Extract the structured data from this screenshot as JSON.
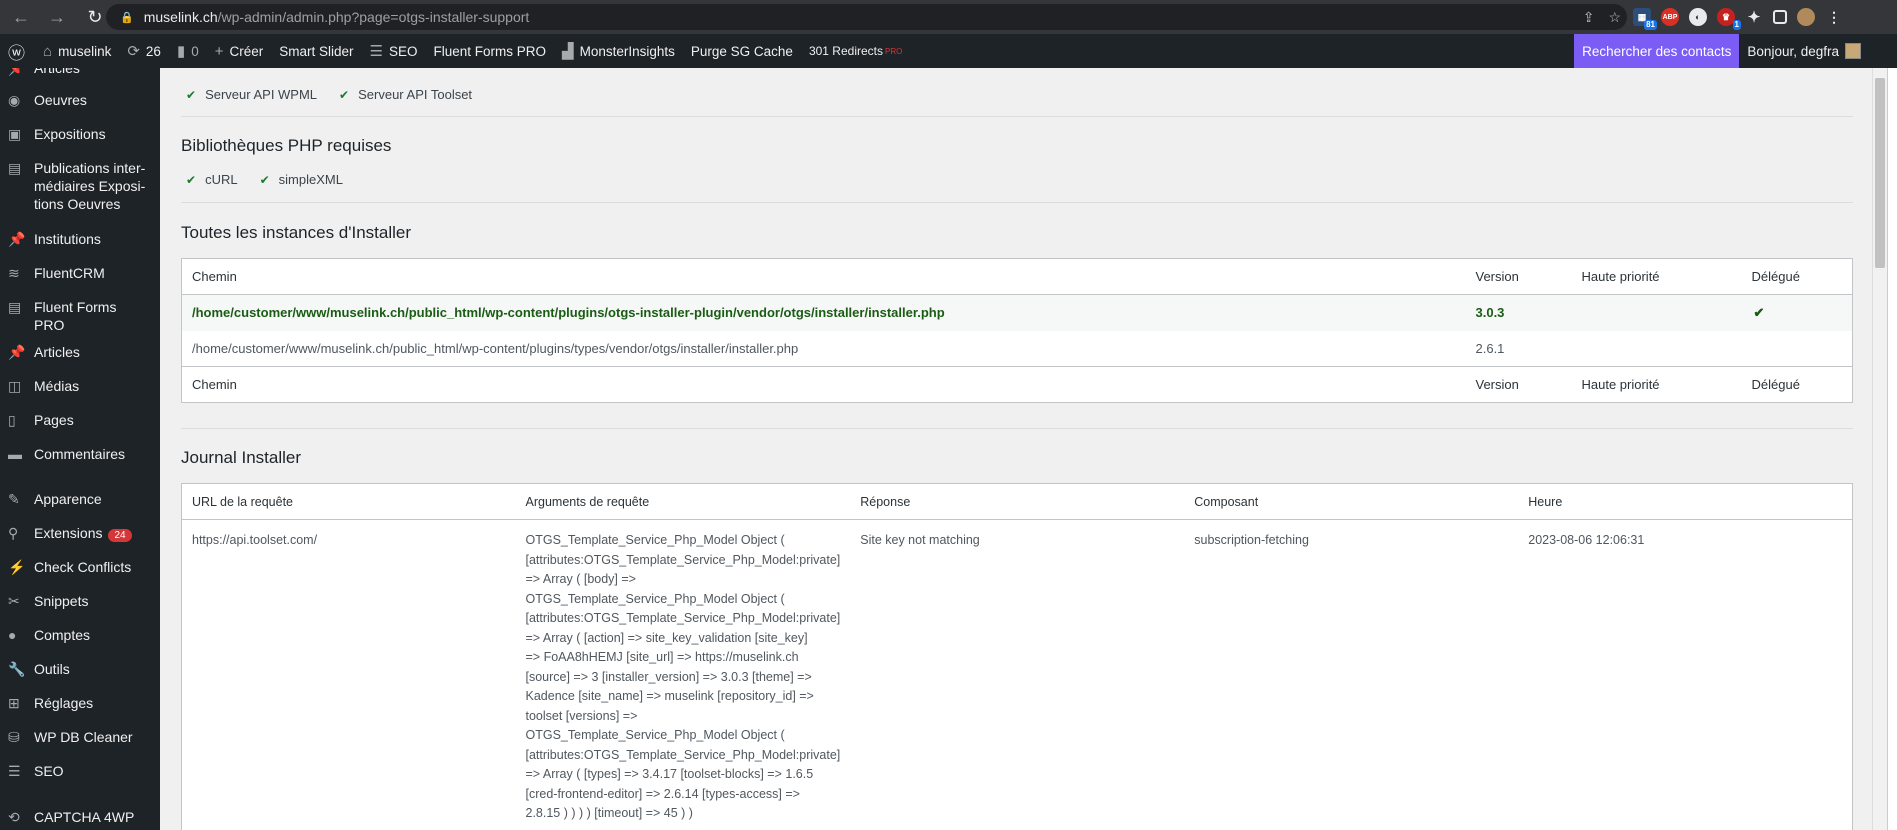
{
  "browser": {
    "url_host": "muselink.ch",
    "url_path": "/wp-admin/admin.php?page=otgs-installer-support",
    "extensions": [
      {
        "name": "ext-a",
        "badge": "81",
        "color": "#2d4d7a"
      },
      {
        "name": "adblock",
        "badge": "",
        "color": "#d93025",
        "text": "ABP"
      },
      {
        "name": "ext-c",
        "badge": "",
        "color": "#e8eaed"
      },
      {
        "name": "ext-d",
        "badge": "1",
        "color": "#c5221f"
      }
    ]
  },
  "adminbar": {
    "site_name": "muselink",
    "updates_count": "26",
    "comments_count": "0",
    "create_label": "Créer",
    "smart_slider": "Smart Slider",
    "seo": "SEO",
    "fluent_forms": "Fluent Forms PRO",
    "monsterinsights": "MonsterInsights",
    "purge_cache": "Purge SG Cache",
    "redirects": "301 Redirects",
    "redirects_badge": "PRO",
    "contacts_button": "Rechercher des contacts",
    "greeting": "Bonjour, degfra"
  },
  "sidebar": {
    "items": [
      {
        "label": "Articles",
        "icon": "pin-icon"
      },
      {
        "label": "Oeuvres",
        "icon": "palette-icon"
      },
      {
        "label": "Expositions",
        "icon": "image-icon"
      },
      {
        "label": "Publications inter-médiaires Exposi-tions Oeuvres",
        "lines": [
          "Publications inter-",
          "médiaires Exposi-",
          "tions Oeuvres"
        ],
        "icon": "store-icon"
      },
      {
        "label": "Institutions",
        "icon": "pin-icon"
      },
      {
        "label": "FluentCRM",
        "icon": "crm-icon"
      },
      {
        "label": "Fluent Forms PRO",
        "icon": "forms-icon"
      },
      {
        "label": "Articles",
        "icon": "pin-icon"
      },
      {
        "label": "Médias",
        "icon": "media-icon"
      },
      {
        "label": "Pages",
        "icon": "page-icon"
      },
      {
        "label": "Commentaires",
        "icon": "comment-icon"
      },
      {
        "label": "Apparence",
        "icon": "brush-icon"
      },
      {
        "label": "Extensions",
        "icon": "plugin-icon",
        "badge": "24"
      },
      {
        "label": "Check Conflicts",
        "icon": "bolt-icon"
      },
      {
        "label": "Snippets",
        "icon": "scissors-icon"
      },
      {
        "label": "Comptes",
        "icon": "user-icon"
      },
      {
        "label": "Outils",
        "icon": "wrench-icon"
      },
      {
        "label": "Réglages",
        "icon": "settings-icon"
      },
      {
        "label": "WP DB Cleaner",
        "icon": "database-icon"
      },
      {
        "label": "SEO",
        "icon": "seo-icon"
      },
      {
        "label": "CAPTCHA 4WP",
        "icon": "captcha-icon"
      }
    ]
  },
  "servers": {
    "items": [
      "Serveur API WPML",
      "Serveur API Toolset"
    ]
  },
  "libraries": {
    "title": "Bibliothèques PHP requises",
    "items": [
      "cURL",
      "simpleXML"
    ]
  },
  "instances": {
    "title": "Toutes les instances d'Installer",
    "columns": [
      "Chemin",
      "Version",
      "Haute priorité",
      "Délégué"
    ],
    "rows": [
      {
        "path": "/home/customer/www/muselink.ch/public_html/wp-content/plugins/otgs-installer-plugin/vendor/otgs/installer/installer.php",
        "version": "3.0.3",
        "priority": "",
        "delegate": "✔"
      },
      {
        "path": "/home/customer/www/muselink.ch/public_html/wp-content/plugins/types/vendor/otgs/installer/installer.php",
        "version": "2.6.1",
        "priority": "",
        "delegate": ""
      }
    ]
  },
  "journal": {
    "title": "Journal Installer",
    "columns": [
      "URL de la requête",
      "Arguments de requête",
      "Réponse",
      "Composant",
      "Heure"
    ],
    "rows": [
      {
        "url": "https://api.toolset.com/",
        "args_lines": [
          "OTGS_Template_Service_Php_Model Object (",
          "[attributes:OTGS_Template_Service_Php_Model:private]",
          "=> Array ( [body] =>",
          "OTGS_Template_Service_Php_Model Object (",
          "[attributes:OTGS_Template_Service_Php_Model:private]",
          "=> Array ( [action] => site_key_validation [site_key]",
          "=> FoAA8hHEMJ [site_url] => https://muselink.ch",
          "[source] => 3 [installer_version] => 3.0.3 [theme] =>",
          "Kadence [site_name] => muselink [repository_id] =>",
          "toolset [versions] =>",
          "OTGS_Template_Service_Php_Model Object (",
          "[attributes:OTGS_Template_Service_Php_Model:private]",
          "=> Array ( [types] => 3.4.17 [toolset-blocks] => 1.6.5",
          "[cred-frontend-editor] => 2.6.14 [types-access] =>",
          "2.8.15 ) ) ) ) [timeout] => 45 ) )"
        ],
        "response": "Site key not matching",
        "component": "subscription-fetching",
        "time": "2023-08-06 12:06:31"
      }
    ]
  }
}
